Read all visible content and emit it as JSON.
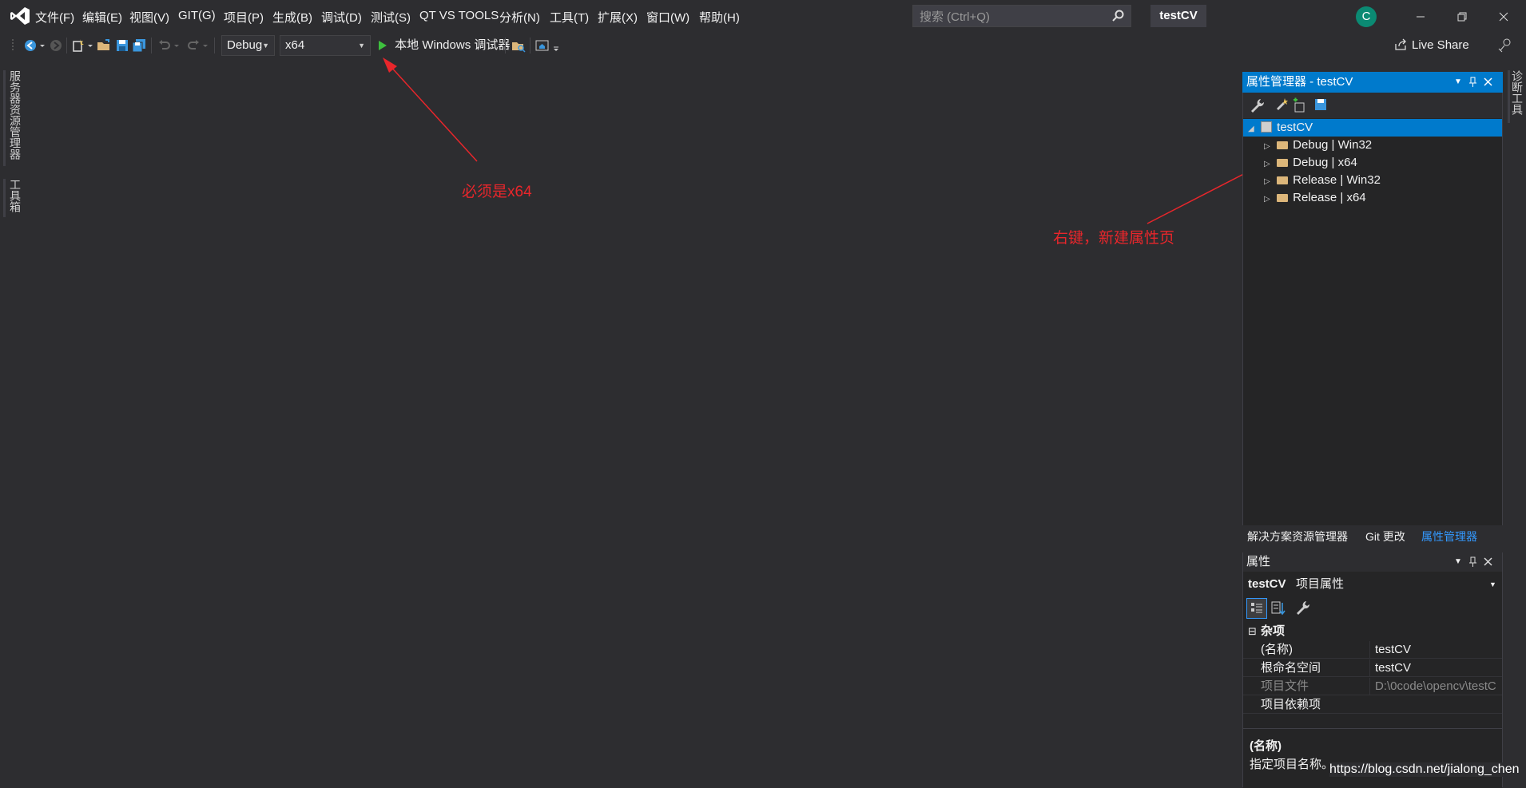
{
  "menu": {
    "items": [
      "文件(F)",
      "编辑(E)",
      "视图(V)",
      "GIT(G)",
      "项目(P)",
      "生成(B)",
      "调试(D)",
      "测试(S)",
      "QT VS TOOLS",
      "分析(N)",
      "工具(T)",
      "扩展(X)",
      "窗口(W)",
      "帮助(H)"
    ],
    "search_placeholder": "搜索 (Ctrl+Q)",
    "solution_name": "testCV",
    "avatar_letter": "C"
  },
  "toolbar": {
    "config": "Debug",
    "platform": "x64",
    "run_label": "本地 Windows 调试器",
    "live_share": "Live Share"
  },
  "left_tabs": {
    "server_explorer": "服务器资源管理器",
    "toolbox": "工具箱"
  },
  "right_edge_tab": "诊断工具",
  "property_manager": {
    "title": "属性管理器 - testCV",
    "root": "testCV",
    "items": [
      "Debug | Win32",
      "Debug | x64",
      "Release | Win32",
      "Release | x64"
    ]
  },
  "bottom_tabs": [
    "解决方案资源管理器",
    "Git 更改",
    "属性管理器"
  ],
  "properties": {
    "title": "属性",
    "object_name": "testCV",
    "object_type": "项目属性",
    "category": "杂项",
    "rows": [
      {
        "name": "(名称)",
        "value": "testCV"
      },
      {
        "name": "根命名空间",
        "value": "testCV"
      },
      {
        "name": "项目文件",
        "value": "D:\\0code\\opencv\\testC"
      },
      {
        "name": "项目依赖项",
        "value": ""
      }
    ],
    "desc_title": "(名称)",
    "desc_text": "指定项目名称。"
  },
  "annotations": {
    "must_x64": "必须是x64",
    "right_click": "右键，新建属性页"
  },
  "watermark": "https://blog.csdn.net/jialong_chen",
  "colors": {
    "background": "#2d2d30",
    "accent": "#007acc",
    "annotation": "#e8262b"
  }
}
